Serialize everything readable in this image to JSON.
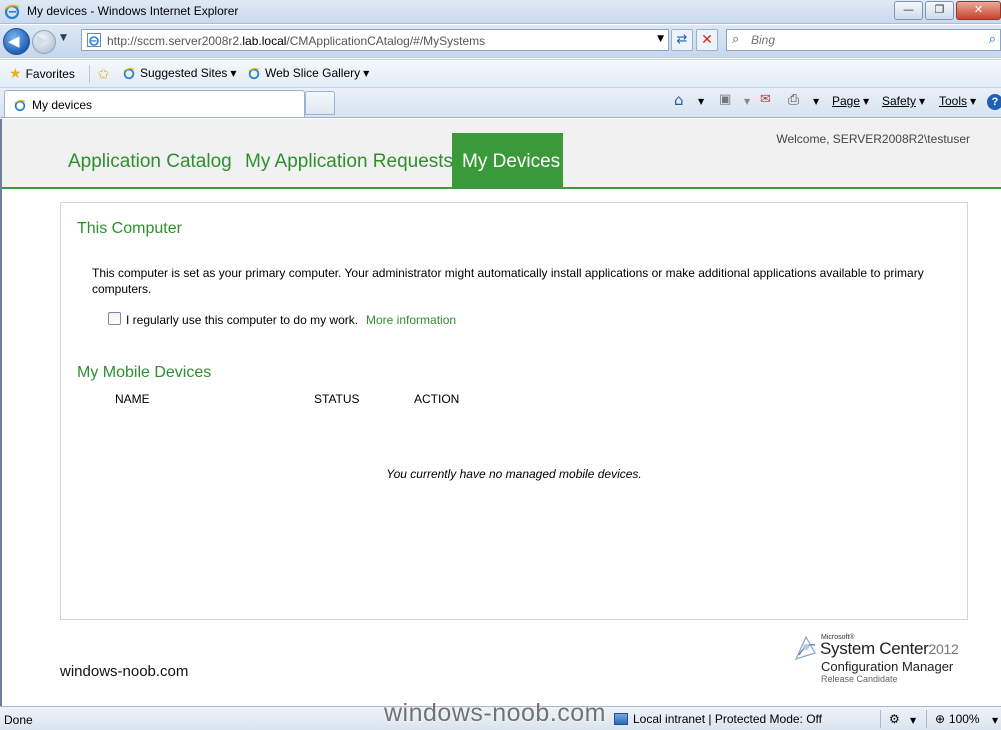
{
  "window": {
    "title": "My devices - Windows Internet Explorer",
    "minimize_glyph": "—",
    "restore_glyph": "❐",
    "close_glyph": "✕"
  },
  "address_bar": {
    "url_prefix": "http://sccm.server2008r2.",
    "url_domain": "lab.local",
    "url_suffix": "/CMApplicationCAtalog/#/MySystems",
    "search_placeholder": "Bing"
  },
  "favorites_bar": {
    "favorites_label": "Favorites",
    "suggested_sites_label": "Suggested Sites",
    "web_slice_gallery_label": "Web Slice Gallery"
  },
  "tabs": {
    "active_tab_label": "My devices"
  },
  "command_bar": {
    "page_label": "Page",
    "safety_label": "Safety",
    "tools_label": "Tools",
    "help_glyph": "?"
  },
  "app": {
    "nav": {
      "application_catalog": "Application Catalog",
      "my_application_requests": "My Application Requests",
      "my_devices": "My Devices"
    },
    "welcome": "Welcome, SERVER2008R2\\testuser",
    "this_computer": {
      "title": "This Computer",
      "description": "This computer is set as your primary computer. Your administrator might automatically install applications or make additional applications available to primary computers.",
      "checkbox_label": "I regularly use this computer to do my work.",
      "checkbox_checked": false,
      "more_information": "More information"
    },
    "mobile_devices": {
      "title": "My Mobile Devices",
      "columns": [
        "NAME",
        "STATUS",
        "ACTION"
      ],
      "empty_message": "You currently have no managed mobile devices."
    },
    "footer_site": "windows-noob.com",
    "logo": {
      "microsoft": "Microsoft®",
      "system_center": "System Center",
      "year": "2012",
      "product": "Configuration Manager",
      "edition": "Release Candidate"
    }
  },
  "status_bar": {
    "status": "Done",
    "zone": "Local intranet | Protected Mode: Off",
    "zoom": "100%"
  },
  "watermark": "windows-noob.com",
  "colors": {
    "accent_green": "#3a9a3a",
    "link_green": "#2f8f2f"
  }
}
